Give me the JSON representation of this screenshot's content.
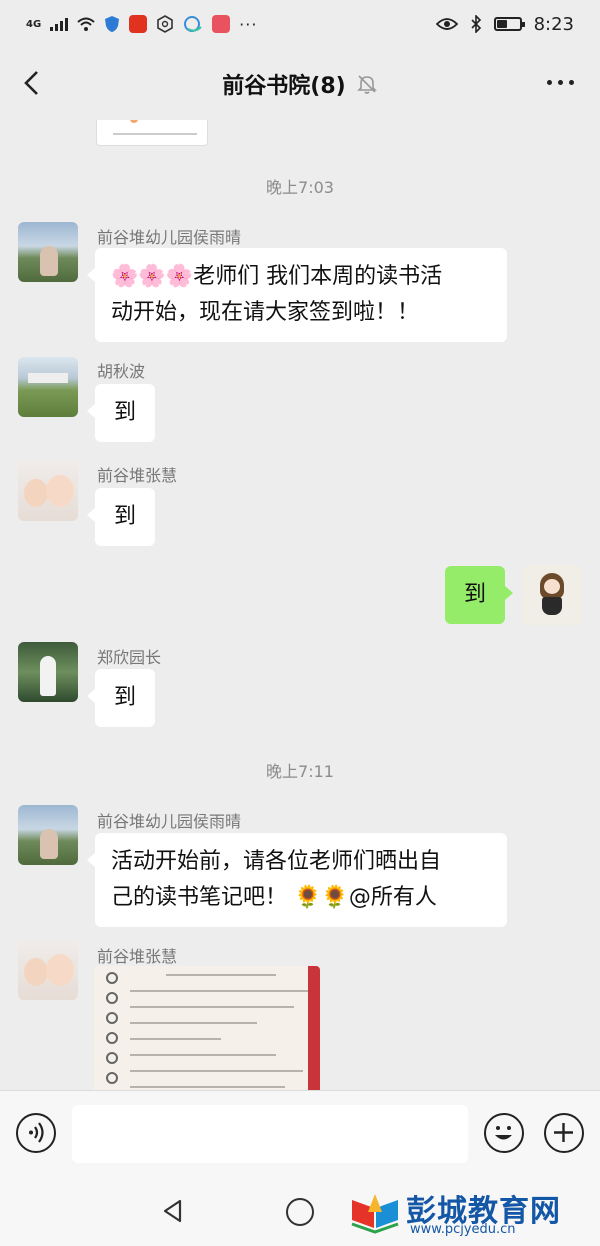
{
  "status_bar": {
    "network": "4G",
    "time": "8:23",
    "battery_level": 0.5,
    "app_icons": [
      "wifi-icon",
      "shield-icon",
      "xuexi-app-icon",
      "hexagon-icon",
      "cloud-app-icon",
      "red-app-icon"
    ]
  },
  "header": {
    "title": "前谷书院(8)",
    "muted": true
  },
  "messages": [
    {
      "type": "timestamp",
      "text": "晚上7:03"
    },
    {
      "type": "incoming",
      "sender": "前谷堆幼儿园侯雨晴",
      "emoji": "🌸🌸🌸",
      "text_line1": "老师们 我们本周的读书活",
      "text_line2": "动开始，现在请大家签到啦！！"
    },
    {
      "type": "incoming",
      "sender": "胡秋波",
      "text": "到"
    },
    {
      "type": "incoming",
      "sender": "前谷堆张慧",
      "text": "到"
    },
    {
      "type": "outgoing",
      "text": "到"
    },
    {
      "type": "incoming",
      "sender": "郑欣园长",
      "text": "到"
    },
    {
      "type": "timestamp",
      "text": "晚上7:11"
    },
    {
      "type": "incoming",
      "sender": "前谷堆幼儿园侯雨晴",
      "text_line1": "活动开始前，请各位老师们晒出自",
      "text_line2": "己的读书笔记吧！",
      "emoji": "🌻🌻",
      "mention": "@所有人"
    },
    {
      "type": "incoming-image",
      "sender": "前谷堆张慧",
      "image": "handwritten-notebook-photo"
    }
  ],
  "input_bar": {
    "placeholder": ""
  },
  "watermark": {
    "name": "彭城教育网",
    "url": "www.pcjyedu.cn"
  },
  "colors": {
    "background": "#ededed",
    "outgoing_bubble": "#95ec69",
    "incoming_bubble": "#ffffff",
    "watermark": "#1457a6"
  }
}
